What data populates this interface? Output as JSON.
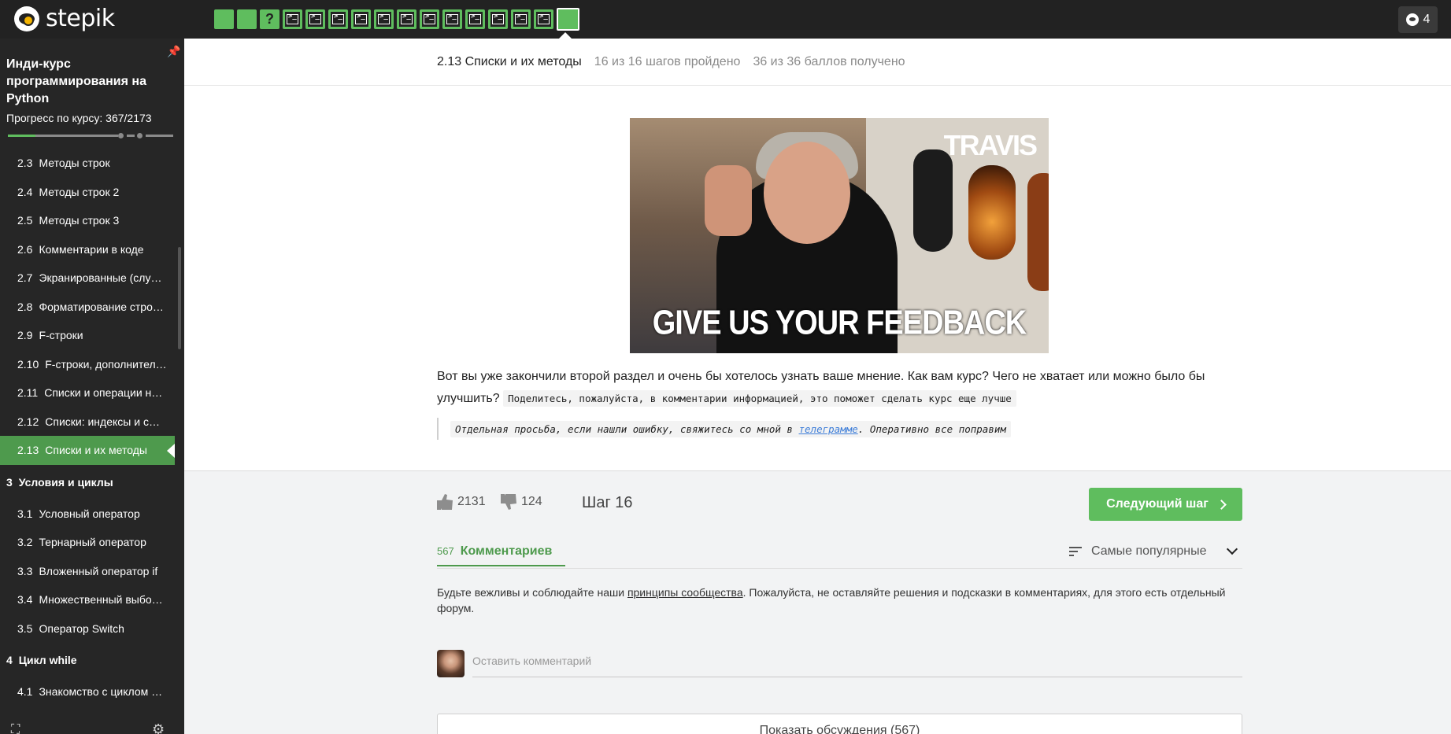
{
  "app": {
    "logo_text": "stepik"
  },
  "steps": [
    {
      "kind": "text",
      "icon": "text-step-icon"
    },
    {
      "kind": "text",
      "icon": "text-step-icon"
    },
    {
      "kind": "quiz",
      "icon": "question-icon",
      "label": "?"
    },
    {
      "kind": "code",
      "icon": "terminal-icon"
    },
    {
      "kind": "code",
      "icon": "terminal-icon"
    },
    {
      "kind": "code",
      "icon": "terminal-icon"
    },
    {
      "kind": "code",
      "icon": "terminal-icon"
    },
    {
      "kind": "code",
      "icon": "terminal-icon"
    },
    {
      "kind": "code",
      "icon": "terminal-icon"
    },
    {
      "kind": "code",
      "icon": "terminal-icon"
    },
    {
      "kind": "code",
      "icon": "terminal-icon"
    },
    {
      "kind": "code",
      "icon": "terminal-icon"
    },
    {
      "kind": "code",
      "icon": "terminal-icon"
    },
    {
      "kind": "code",
      "icon": "terminal-icon"
    },
    {
      "kind": "code",
      "icon": "terminal-icon"
    },
    {
      "kind": "text",
      "icon": "text-step-icon",
      "active": true
    }
  ],
  "notifications": {
    "count": "4",
    "icon": "notification-icon"
  },
  "sidebar": {
    "course_title": "Инди-курс программирования на Python",
    "progress_label": "Прогресс по курсу:",
    "progress_value": "367/2173",
    "progress_fraction": 0.169,
    "lessons_before": [
      {
        "num": "2.3",
        "title": "Методы строк"
      },
      {
        "num": "2.4",
        "title": "Методы строк 2"
      },
      {
        "num": "2.5",
        "title": "Методы строк 3"
      },
      {
        "num": "2.6",
        "title": "Комментарии в коде"
      },
      {
        "num": "2.7",
        "title": "Экранированные (слу…"
      },
      {
        "num": "2.8",
        "title": "Форматирование стро…"
      },
      {
        "num": "2.9",
        "title": "F-строки"
      },
      {
        "num": "2.10",
        "title": "F-строки, дополнител…"
      },
      {
        "num": "2.11",
        "title": "Списки и операции н…"
      },
      {
        "num": "2.12",
        "title": "Списки: индексы и с…"
      }
    ],
    "active_lesson": {
      "num": "2.13",
      "title": "Списки и их методы"
    },
    "section3": {
      "num": "3",
      "title": "Условия и циклы"
    },
    "section3_lessons": [
      {
        "num": "3.1",
        "title": "Условный оператор"
      },
      {
        "num": "3.2",
        "title": "Тернарный оператор"
      },
      {
        "num": "3.3",
        "title": "Вложенный оператор if"
      },
      {
        "num": "3.4",
        "title": "Множественный выбо…"
      },
      {
        "num": "3.5",
        "title": "Оператор Switch"
      }
    ],
    "section4": {
      "num": "4",
      "title": "Цикл while"
    },
    "section4_lessons": [
      {
        "num": "4.1",
        "title": "Знакомство с циклом …"
      }
    ]
  },
  "lesson_header": {
    "title": "2.13 Списки и их методы",
    "steps_passed": "16 из 16 шагов пройдено",
    "score": "36 из 36 баллов  получено"
  },
  "media": {
    "logo": "TRAVIS",
    "caption": "GIVE US YOUR FEEDBACK"
  },
  "content": {
    "paragraph": "Вот вы уже закончили второй раздел и очень бы хотелось узнать ваше мнение. Как вам курс? Чего не хватает или можно было бы улучшить?",
    "inline_code": "Поделитесь, пожалуйста, в комментарии информацией, это поможет сделать курс еще лучше",
    "quote_before": "Отдельная просьба, если нашли ошибку, свяжитесь со мной в ",
    "quote_link": "телеграмме",
    "quote_after": ". Оперативно все поправим"
  },
  "footer": {
    "likes": "2131",
    "dislikes": "124",
    "step_label": "Шаг 16",
    "next_button": "Следующий шаг"
  },
  "comments": {
    "count": "567",
    "tab_label": "Комментариев",
    "sort_label": "Самые популярные",
    "rules_before": "Будьте вежливы и соблюдайте наши ",
    "rules_link": "принципы сообщества",
    "rules_after": ". Пожалуйста, не оставляйте решения и подсказки в комментариях, для этого есть отдельный форум.",
    "input_placeholder": "Оставить комментарий",
    "show_discussions": "Показать обсуждения (567)"
  }
}
